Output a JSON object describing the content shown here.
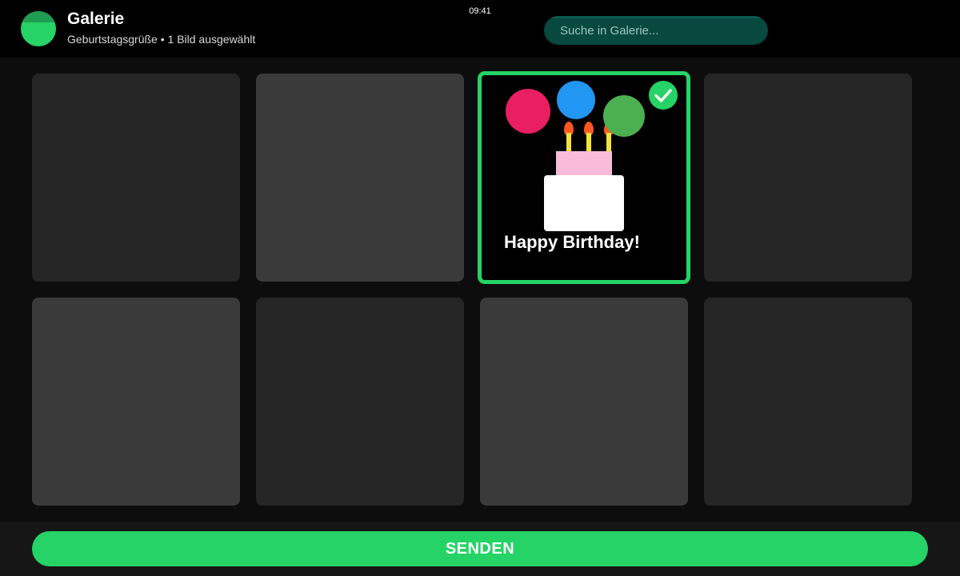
{
  "header": {
    "title": "Galerie",
    "subtitle": "Geburtstagsgrüße • 1 Bild ausgewählt",
    "clock": "09:41",
    "avatar_color": "#25d366"
  },
  "search": {
    "placeholder": "Suche in Galerie..."
  },
  "gallery": {
    "selected_index": 3,
    "selected_image": {
      "greeting": "Happy Birthday!",
      "balloon_colors": [
        "#e91e63",
        "#2196f3",
        "#4caf50"
      ],
      "candle_count": 3
    },
    "selection_indicator_icon": "check-icon",
    "accent_color": "#25d366"
  },
  "footer": {
    "send_label": "SENDEN"
  }
}
